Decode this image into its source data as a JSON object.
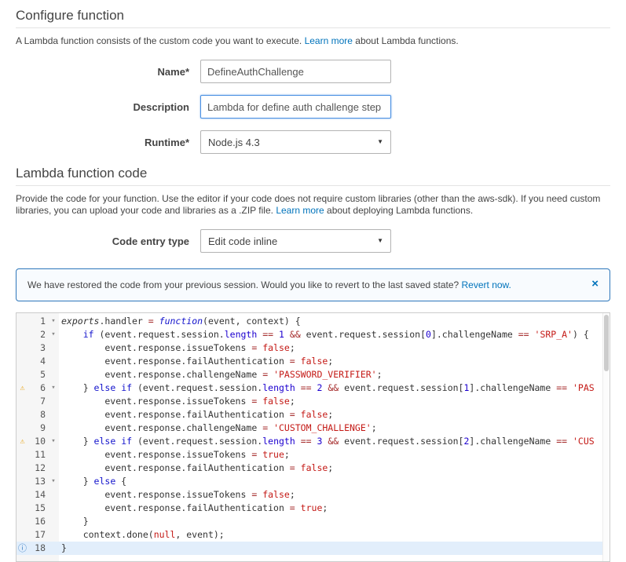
{
  "colors": {
    "link": "#0073bb",
    "alert-border": "#2e77bb",
    "focus": "#4a90e2",
    "active-line": "#e2eefb",
    "warning": "#e9a820",
    "info": "#3b7fc4"
  },
  "icons": {
    "close": "×",
    "caret": "▼"
  },
  "configure": {
    "heading": "Configure function",
    "desc_before": "A Lambda function consists of the custom code you want to execute.",
    "learn_more": "Learn more",
    "desc_after": "about Lambda functions."
  },
  "form": {
    "name_label": "Name*",
    "name_value": "DefineAuthChallenge",
    "description_label": "Description",
    "description_value": "Lambda for define auth challenge step",
    "runtime_label": "Runtime*",
    "runtime_value": "Node.js 4.3"
  },
  "code_section": {
    "heading": "Lambda function code",
    "desc_before": "Provide the code for your function. Use the editor if your code does not require custom libraries (other than the aws-sdk). If you need custom libraries, you can upload your code and libraries as a .ZIP file.",
    "learn_more": "Learn more",
    "desc_after": "about deploying Lambda functions.",
    "entry_type_label": "Code entry type",
    "entry_type_value": "Edit code inline"
  },
  "alert": {
    "message": "We have restored the code from your previous session. Would you like to revert to the last saved state?",
    "link": "Revert now."
  },
  "editor": {
    "icons": {
      "warning": "⚠",
      "info": "ⓘ",
      "fold": "▾"
    },
    "lines": [
      {
        "num": "1",
        "fold": true,
        "marker": "",
        "active": false,
        "tokens": [
          [
            "ex",
            "exports"
          ],
          [
            "pl",
            ".handler "
          ],
          [
            "op",
            "="
          ],
          [
            "pl",
            " "
          ],
          [
            "fn",
            "function"
          ],
          [
            "pl",
            "(event, context) {"
          ]
        ]
      },
      {
        "num": "2",
        "fold": true,
        "marker": "",
        "active": false,
        "tokens": [
          [
            "pl",
            "    "
          ],
          [
            "kw",
            "if"
          ],
          [
            "pl",
            " (event.request.session."
          ],
          [
            "su",
            "length"
          ],
          [
            "pl",
            " "
          ],
          [
            "op",
            "=="
          ],
          [
            "pl",
            " "
          ],
          [
            "nu",
            "1"
          ],
          [
            "pl",
            " "
          ],
          [
            "op",
            "&&"
          ],
          [
            "pl",
            " event.request.session["
          ],
          [
            "nu",
            "0"
          ],
          [
            "pl",
            "].challengeName "
          ],
          [
            "op",
            "=="
          ],
          [
            "pl",
            " "
          ],
          [
            "st",
            "'SRP_A'"
          ],
          [
            "pl",
            ") {"
          ]
        ]
      },
      {
        "num": "3",
        "fold": false,
        "marker": "",
        "active": false,
        "tokens": [
          [
            "pl",
            "        event.response.issueTokens "
          ],
          [
            "op",
            "="
          ],
          [
            "pl",
            " "
          ],
          [
            "bo",
            "false"
          ],
          [
            "pl",
            ";"
          ]
        ]
      },
      {
        "num": "4",
        "fold": false,
        "marker": "",
        "active": false,
        "tokens": [
          [
            "pl",
            "        event.response.failAuthentication "
          ],
          [
            "op",
            "="
          ],
          [
            "pl",
            " "
          ],
          [
            "bo",
            "false"
          ],
          [
            "pl",
            ";"
          ]
        ]
      },
      {
        "num": "5",
        "fold": false,
        "marker": "",
        "active": false,
        "tokens": [
          [
            "pl",
            "        event.response.challengeName "
          ],
          [
            "op",
            "="
          ],
          [
            "pl",
            " "
          ],
          [
            "st",
            "'PASSWORD_VERIFIER'"
          ],
          [
            "pl",
            ";"
          ]
        ]
      },
      {
        "num": "6",
        "fold": true,
        "marker": "warning",
        "active": false,
        "tokens": [
          [
            "pl",
            "    } "
          ],
          [
            "kw",
            "else"
          ],
          [
            "pl",
            " "
          ],
          [
            "kw",
            "if"
          ],
          [
            "pl",
            " (event.request.session."
          ],
          [
            "su",
            "length"
          ],
          [
            "pl",
            " "
          ],
          [
            "op",
            "=="
          ],
          [
            "pl",
            " "
          ],
          [
            "nu",
            "2"
          ],
          [
            "pl",
            " "
          ],
          [
            "op",
            "&&"
          ],
          [
            "pl",
            " event.request.session["
          ],
          [
            "nu",
            "1"
          ],
          [
            "pl",
            "].challengeName "
          ],
          [
            "op",
            "=="
          ],
          [
            "pl",
            " "
          ],
          [
            "st",
            "'PAS"
          ]
        ]
      },
      {
        "num": "7",
        "fold": false,
        "marker": "",
        "active": false,
        "tokens": [
          [
            "pl",
            "        event.response.issueTokens "
          ],
          [
            "op",
            "="
          ],
          [
            "pl",
            " "
          ],
          [
            "bo",
            "false"
          ],
          [
            "pl",
            ";"
          ]
        ]
      },
      {
        "num": "8",
        "fold": false,
        "marker": "",
        "active": false,
        "tokens": [
          [
            "pl",
            "        event.response.failAuthentication "
          ],
          [
            "op",
            "="
          ],
          [
            "pl",
            " "
          ],
          [
            "bo",
            "false"
          ],
          [
            "pl",
            ";"
          ]
        ]
      },
      {
        "num": "9",
        "fold": false,
        "marker": "",
        "active": false,
        "tokens": [
          [
            "pl",
            "        event.response.challengeName "
          ],
          [
            "op",
            "="
          ],
          [
            "pl",
            " "
          ],
          [
            "st",
            "'CUSTOM_CHALLENGE'"
          ],
          [
            "pl",
            ";"
          ]
        ]
      },
      {
        "num": "10",
        "fold": true,
        "marker": "warning",
        "active": false,
        "tokens": [
          [
            "pl",
            "    } "
          ],
          [
            "kw",
            "else"
          ],
          [
            "pl",
            " "
          ],
          [
            "kw",
            "if"
          ],
          [
            "pl",
            " (event.request.session."
          ],
          [
            "su",
            "length"
          ],
          [
            "pl",
            " "
          ],
          [
            "op",
            "=="
          ],
          [
            "pl",
            " "
          ],
          [
            "nu",
            "3"
          ],
          [
            "pl",
            " "
          ],
          [
            "op",
            "&&"
          ],
          [
            "pl",
            " event.request.session["
          ],
          [
            "nu",
            "2"
          ],
          [
            "pl",
            "].challengeName "
          ],
          [
            "op",
            "=="
          ],
          [
            "pl",
            " "
          ],
          [
            "st",
            "'CUS"
          ]
        ]
      },
      {
        "num": "11",
        "fold": false,
        "marker": "",
        "active": false,
        "tokens": [
          [
            "pl",
            "        event.response.issueTokens "
          ],
          [
            "op",
            "="
          ],
          [
            "pl",
            " "
          ],
          [
            "bo",
            "true"
          ],
          [
            "pl",
            ";"
          ]
        ]
      },
      {
        "num": "12",
        "fold": false,
        "marker": "",
        "active": false,
        "tokens": [
          [
            "pl",
            "        event.response.failAuthentication "
          ],
          [
            "op",
            "="
          ],
          [
            "pl",
            " "
          ],
          [
            "bo",
            "false"
          ],
          [
            "pl",
            ";"
          ]
        ]
      },
      {
        "num": "13",
        "fold": true,
        "marker": "",
        "active": false,
        "tokens": [
          [
            "pl",
            "    } "
          ],
          [
            "kw",
            "else"
          ],
          [
            "pl",
            " {"
          ]
        ]
      },
      {
        "num": "14",
        "fold": false,
        "marker": "",
        "active": false,
        "tokens": [
          [
            "pl",
            "        event.response.issueTokens "
          ],
          [
            "op",
            "="
          ],
          [
            "pl",
            " "
          ],
          [
            "bo",
            "false"
          ],
          [
            "pl",
            ";"
          ]
        ]
      },
      {
        "num": "15",
        "fold": false,
        "marker": "",
        "active": false,
        "tokens": [
          [
            "pl",
            "        event.response.failAuthentication "
          ],
          [
            "op",
            "="
          ],
          [
            "pl",
            " "
          ],
          [
            "bo",
            "true"
          ],
          [
            "pl",
            ";"
          ]
        ]
      },
      {
        "num": "16",
        "fold": false,
        "marker": "",
        "active": false,
        "tokens": [
          [
            "pl",
            "    }"
          ]
        ]
      },
      {
        "num": "17",
        "fold": false,
        "marker": "",
        "active": false,
        "tokens": [
          [
            "pl",
            "    context.done("
          ],
          [
            "bo",
            "null"
          ],
          [
            "pl",
            ", event);"
          ]
        ]
      },
      {
        "num": "18",
        "fold": false,
        "marker": "info",
        "active": true,
        "tokens": [
          [
            "pl",
            "}"
          ]
        ]
      }
    ]
  }
}
